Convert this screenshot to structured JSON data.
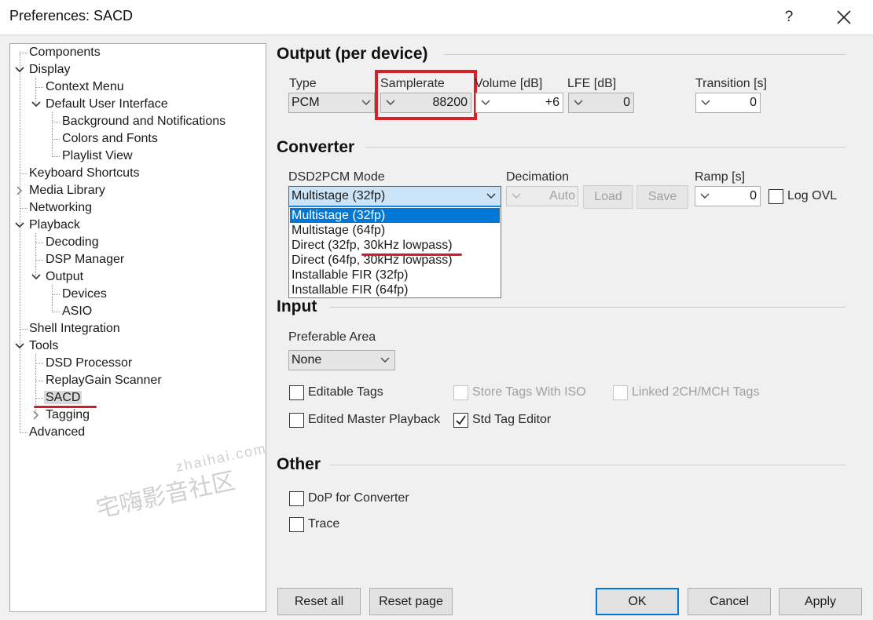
{
  "window": {
    "title": "Preferences: SACD",
    "help_label": "?"
  },
  "tree": {
    "items": [
      {
        "label": "Components"
      },
      {
        "label": "Display"
      },
      {
        "label": "Context Menu"
      },
      {
        "label": "Default User Interface"
      },
      {
        "label": "Background and Notifications"
      },
      {
        "label": "Colors and Fonts"
      },
      {
        "label": "Playlist View"
      },
      {
        "label": "Keyboard Shortcuts"
      },
      {
        "label": "Media Library"
      },
      {
        "label": "Networking"
      },
      {
        "label": "Playback"
      },
      {
        "label": "Decoding"
      },
      {
        "label": "DSP Manager"
      },
      {
        "label": "Output"
      },
      {
        "label": "Devices"
      },
      {
        "label": "ASIO"
      },
      {
        "label": "Shell Integration"
      },
      {
        "label": "Tools"
      },
      {
        "label": "DSD Processor"
      },
      {
        "label": "ReplayGain Scanner"
      },
      {
        "label": "SACD"
      },
      {
        "label": "Tagging"
      },
      {
        "label": "Advanced"
      }
    ]
  },
  "output": {
    "heading": "Output (per device)",
    "type": {
      "label": "Type",
      "value": "PCM"
    },
    "samplerate": {
      "label": "Samplerate",
      "value": "88200"
    },
    "volume": {
      "label": "Volume [dB]",
      "value": "+6"
    },
    "lfe": {
      "label": "LFE [dB]",
      "value": "0"
    },
    "transition": {
      "label": "Transition [s]",
      "value": "0"
    }
  },
  "converter": {
    "heading": "Converter",
    "mode": {
      "label": "DSD2PCM Mode",
      "value": "Multistage (32fp)",
      "options": [
        "Multistage (32fp)",
        "Multistage (64fp)",
        "Direct (32fp, 30kHz lowpass)",
        "Direct (64fp, 30kHz lowpass)",
        "Installable FIR (32fp)",
        "Installable FIR (64fp)"
      ]
    },
    "decimation": {
      "label": "Decimation",
      "value": "Auto"
    },
    "load_label": "Load",
    "save_label": "Save",
    "ramp": {
      "label": "Ramp [s]",
      "value": "0"
    },
    "log_ovl_label": "Log OVL"
  },
  "input": {
    "heading": "Input",
    "area": {
      "label": "Preferable Area",
      "value": "None"
    },
    "editable_tags": {
      "label": "Editable Tags",
      "checked": false
    },
    "store_tags_iso": {
      "label": "Store Tags With ISO",
      "checked": false
    },
    "linked_tags": {
      "label": "Linked 2CH/MCH Tags",
      "checked": false
    },
    "edited_master": {
      "label": "Edited Master Playback",
      "checked": false
    },
    "std_tag_editor": {
      "label": "Std Tag Editor",
      "checked": true
    }
  },
  "other": {
    "heading": "Other",
    "dop": {
      "label": "DoP for Converter",
      "checked": false
    },
    "trace": {
      "label": "Trace",
      "checked": false
    }
  },
  "buttons": {
    "reset_all": "Reset all",
    "reset_page": "Reset page",
    "ok": "OK",
    "cancel": "Cancel",
    "apply": "Apply"
  },
  "watermark": {
    "site": "zhaihai.com",
    "text": "宅嗨影音社区"
  },
  "colors": {
    "selection": "#0078d7",
    "annotation_red": "#d9202a"
  }
}
